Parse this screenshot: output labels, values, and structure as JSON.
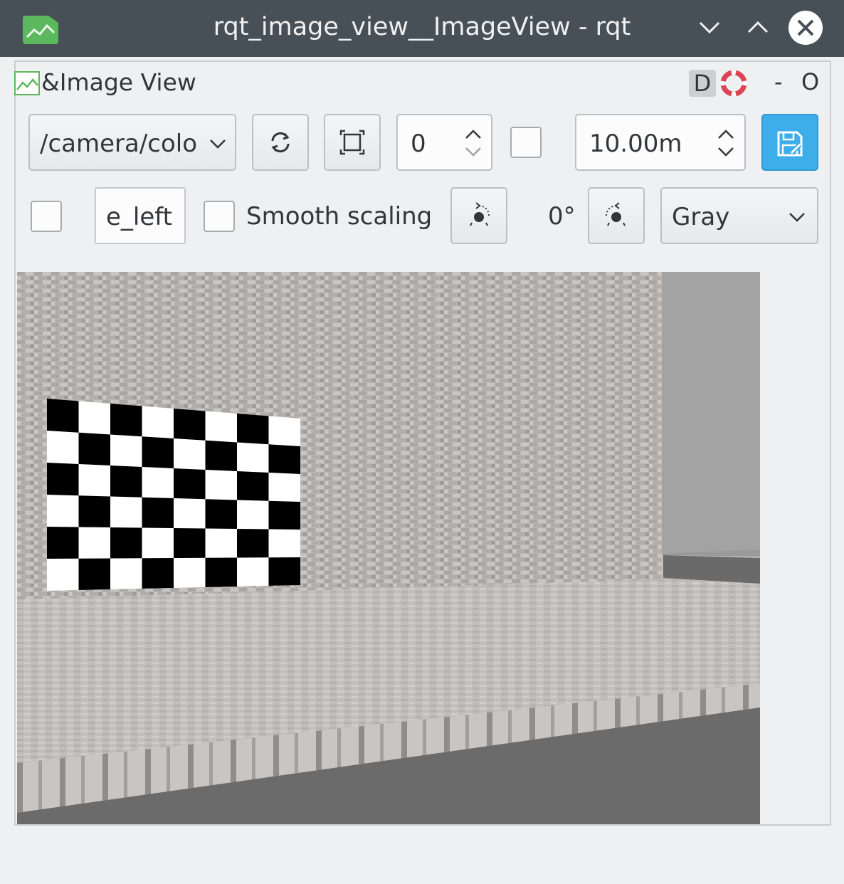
{
  "window": {
    "title": "rqt_image_view__ImageView - rqt",
    "icons": [
      "image-app-icon",
      "chevron-down-icon",
      "chevron-up-icon",
      "close-icon"
    ]
  },
  "plugin": {
    "title": "&Image View",
    "dock_d": "D",
    "dock_minus": "-",
    "dock_close": "O"
  },
  "toolbar": {
    "topic": "/camera/colo",
    "number_value": "0",
    "duration_value": "10.00m",
    "mouse_topic": "e_left",
    "smooth_scaling_label": "Smooth scaling",
    "rotation": "0°",
    "color_scheme": "Gray",
    "smooth_scaling_checked": false,
    "dynamic_range_checked": false,
    "mouse_publish_checked": false
  },
  "colors": {
    "titlebar": "#475057",
    "accent": "#3daee9",
    "background": "#eff0f1"
  }
}
